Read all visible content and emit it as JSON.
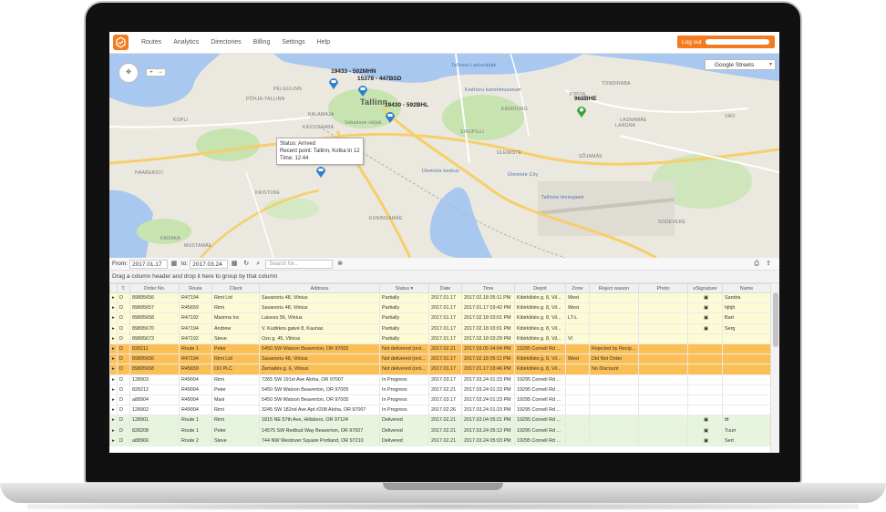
{
  "nav": {
    "items": [
      "Routes",
      "Analytics",
      "Directories",
      "Billing",
      "Settings",
      "Help"
    ],
    "logout_label": "Log out"
  },
  "map": {
    "layer": "Google Streets",
    "city_label": "Tallinn",
    "vehicles": [
      {
        "label": "19433 - 502MHN"
      },
      {
        "label": "15378 - 447BSD"
      },
      {
        "label": "19430 - 592BHL"
      },
      {
        "label": "968BHE"
      }
    ],
    "tooltip": {
      "status": "Status: Arrived",
      "recent_point": "Recent point: Tallinn, Kotka tn 12",
      "time": "Time: 12:44"
    },
    "places": [
      "PELGULINN",
      "PÕHJA-TALLINN",
      "KALAMAJA",
      "KASSISAABA",
      "KADRIORG",
      "PIRITA",
      "LAAGNA",
      "KOPLI",
      "KRISTIINE",
      "MUSTAMÄE",
      "HAABERSTI",
      "KADAKA",
      "ÜLEMISTE",
      "SÕJAMÄE",
      "VÄO",
      "SODEVERE",
      "TONDIRABA",
      "LASNAMÄE",
      "Ülemiste City",
      "Tallinna lennujaam",
      "Ülemiste keskus",
      "Tallinna Lauluväljak",
      "Kadrioru kunstimuuseum",
      "Vabaduse väljak",
      "SIKUPILLI",
      "KUNINGAMÄE"
    ]
  },
  "toolbar": {
    "from_label": "From:",
    "from_date": "2017.01.17",
    "to_label": "to:",
    "to_date": "2017.03.24",
    "search_placeholder": "Search for..."
  },
  "group_hint": "Drag a column header and drop it here to group by that column",
  "columns": [
    "",
    "T.",
    "Order No.",
    "Route",
    "Client",
    "Address",
    "Status ▾",
    "Date",
    "Time",
    "Depot",
    "Zone",
    "Reject reason",
    "Photo",
    "eSignature",
    "Name"
  ],
  "rows": [
    {
      "style": "yellow",
      "cells": [
        "▸",
        "D",
        "89895656",
        "R47194",
        "Rimi Ltd",
        "Savanoriu 48, Vilnius",
        "Partially",
        "2017.01.17",
        "2017.02.18 05:11 PM",
        "Kibirkštiės g. 8, Vil...",
        "West",
        "",
        "",
        "▣",
        "Sandra"
      ]
    },
    {
      "style": "yellow",
      "cells": [
        "▸",
        "D",
        "89895657",
        "R45659",
        "Rimi",
        "Savanoriu 48, Vilnius",
        "Partially",
        "2017.01.17",
        "2017.01.17 03:42 PM",
        "Kibirkštiės g. 8, Vil...",
        "West",
        "",
        "",
        "▣",
        "hjhjh"
      ]
    },
    {
      "style": "yellow",
      "cells": [
        "▸",
        "D",
        "89895658",
        "R47192",
        "Maxima Inc",
        "Laisves 56, Vilnius",
        "Partially",
        "2017.01.17",
        "2017.02.18 03:01 PM",
        "Kibirkštiės g. 8, Vil...",
        "LT-L",
        "",
        "",
        "▣",
        "Bart"
      ]
    },
    {
      "style": "yellow",
      "cells": [
        "▸",
        "D",
        "89895670",
        "R47194",
        "Andrew",
        "V. Kudirkos gatvė 8, Kaunas",
        "Partially",
        "2017.01.17",
        "2017.02.18 03:01 PM",
        "Kibirkštiės g. 8, Vil...",
        "",
        "",
        "",
        "▣",
        "Serg"
      ]
    },
    {
      "style": "yellow",
      "cells": [
        "▸",
        "D",
        "89895673",
        "R47192",
        "Steve",
        "Ozo g. 45, Vilnius",
        "Partially",
        "2017.01.17",
        "2017.02.18 03:29 PM",
        "Kibirkštiės g. 8, Vil...",
        "Vl",
        "",
        "",
        "",
        ""
      ]
    },
    {
      "style": "orange",
      "cells": [
        "▸",
        "D",
        "828211",
        "Route 1",
        "Peter",
        "5450 SW Watson Beaverton, OR 97005",
        "Not delivered (ord...",
        "2017.02.21",
        "2017.03.05 04:04 PM",
        "19295 Cornell Rd ...",
        "",
        "Rejected by Recip...",
        "",
        "",
        ""
      ]
    },
    {
      "style": "orange",
      "cells": [
        "▸",
        "D",
        "89895656",
        "R47194",
        "Rimi Ltd",
        "Savanoriu 48, Vilnius",
        "Not delivered (ord...",
        "2017.01.17",
        "2017.02.18 05:11 PM",
        "Kibirkštiės g. 8, Vil...",
        "West",
        "Did Not Order",
        "",
        "",
        ""
      ]
    },
    {
      "style": "orange",
      "cells": [
        "▸",
        "D",
        "89895658",
        "R45659",
        "DO PLC",
        "Žemaitės g. 6, Vilnius",
        "Not delivered (ord...",
        "2017.01.17",
        "2017.01.17 03:46 PM",
        "Kibirkštiės g. 8, Vil...",
        "",
        "No Discount",
        "",
        "",
        ""
      ]
    },
    {
      "style": "white",
      "cells": [
        "▸",
        "D",
        "128903",
        "R49004",
        "Rimi",
        "7265 SW 191st Ave Aloha, OR 97007",
        "In Progress",
        "2017.03.17",
        "2017.03.24 01:23 PM",
        "19295 Cornell Rd ...",
        "",
        "",
        "",
        "",
        ""
      ]
    },
    {
      "style": "white",
      "cells": [
        "▸",
        "D",
        "828212",
        "R49004",
        "Peter",
        "5450 SW Watson Beaverton, OR 97005",
        "In Progress",
        "2017.02.21",
        "2017.03.24 01:23 PM",
        "19295 Cornell Rd ...",
        "",
        "",
        "",
        "",
        ""
      ]
    },
    {
      "style": "white",
      "cells": [
        "▸",
        "D",
        "a88904",
        "R49004",
        "Maxi",
        "5450 SW Watson Beaverton, OR 97005",
        "In Progress",
        "2017.03.17",
        "2017.03.24 01:23 PM",
        "19295 Cornell Rd ...",
        "",
        "",
        "",
        "",
        ""
      ]
    },
    {
      "style": "white",
      "cells": [
        "▸",
        "D",
        "128902",
        "R49004",
        "Rimi",
        "3245 SW 182nd Ave Apt #208 Aloha, OR 97007",
        "In Progress",
        "2017.02.26",
        "2017.03.24 01:23 PM",
        "19295 Cornell Rd ...",
        "",
        "",
        "",
        "",
        ""
      ]
    },
    {
      "style": "green",
      "cells": [
        "▸",
        "D",
        "128901",
        "Route 1",
        "Rimi",
        "1815 NE 57th Ave, Hillsboro, OR 97124",
        "Delivered",
        "2017.02.21",
        "2017.03.04 05:21 PM",
        "19295 Cornell Rd ...",
        "",
        "",
        "",
        "▣",
        "ttt"
      ]
    },
    {
      "style": "green",
      "cells": [
        "▸",
        "D",
        "828208",
        "Route 1",
        "Peter",
        "14575 SW Redbud Way Beaverton, OR 97007",
        "Delivered",
        "2017.02.21",
        "2017.03.24 05:12 PM",
        "19295 Cornell Rd ...",
        "",
        "",
        "",
        "▣",
        "Tuurr"
      ]
    },
    {
      "style": "green",
      "cells": [
        "▸",
        "D",
        "a88966",
        "Route 2",
        "Steve",
        "744 NW Westover Square Portland, OR 97210",
        "Delivered",
        "2017.02.21",
        "2017.03.24 05:03 PM",
        "19295 Cornell Rd ...",
        "",
        "",
        "",
        "▣",
        "Sert"
      ]
    }
  ]
}
